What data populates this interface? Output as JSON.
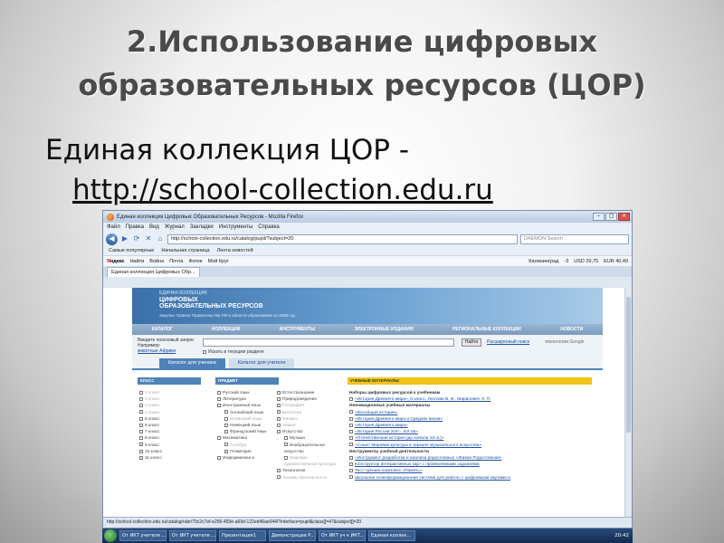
{
  "slide": {
    "title_line1": "2.Использование цифровых",
    "title_line2": "образовательных ресурсов (ЦОР)",
    "subtitle": "Единая коллекция ЦОР -",
    "url": "http://school-collection.edu.ru "
  },
  "browser": {
    "window_title": "Единая коллекция Цифровых Образовательных Ресурсов - Mozilla Firefox",
    "menu": [
      "Файл",
      "Правка",
      "Вид",
      "Журнал",
      "Закладки",
      "Инструменты",
      "Справка"
    ],
    "address": "http://school-collection.edu.ru/catalog/pupil/?subject=20",
    "search_placeholder": "DAEMON Search",
    "bookmarks": [
      "Самые популярные",
      "Начальная страница",
      "Лента новостей"
    ],
    "yandex_bar": {
      "logo_y": "Я",
      "logo_rest": "ндекс",
      "find": "Найти",
      "items": [
        "Война",
        "Почта",
        "Фотки",
        "Мой Круг"
      ],
      "city": "Калининград",
      "temp": "-3",
      "usd": "USD 29,75",
      "eur": "EUR 40,49"
    },
    "tab_label": "Единая коллекция Цифровых Обр...",
    "status": "http://school-collection.edu.ru/catalog/rubr/79c2c7ef-e256-493e-a69d-122ed46ae044/?interface=pupil&class[]=47&subject[]=20"
  },
  "site": {
    "banner_small": "ЕДИНАЯ КОЛЛЕКЦИЯ",
    "banner_big_1": "ЦИФРОВЫХ",
    "banner_big_2": "ОБРАЗОВАТЕЛЬНЫХ РЕСУРСОВ",
    "banner_note": "Закупка: Правое Правительства РФ в области образования за 2008 год",
    "nav": [
      "КАТАЛОГ",
      "КОЛЛЕКЦИИ",
      "ИНСТРУМЕНТЫ",
      "ЭЛЕКТРОННЫЕ ИЗДАНИЯ",
      "РЕГИОНАЛЬНЫЕ КОЛЛЕКЦИИ",
      "НОВОСТИ"
    ],
    "search_label_1": "Введите поисковый запрос",
    "search_label_2": "Например:",
    "search_example": "животные Африки",
    "search_button": "Найти",
    "advanced": "Расширенный поиск",
    "google": "технологии Google",
    "in_section": "Искать в текущем разделе",
    "tab_student": "Каталог для ученика",
    "tab_teacher": "Каталог для учителя",
    "col_class": "КЛАСС",
    "col_subject": "ПРЕДМЕТ",
    "col_materials": "УЧЕБНЫЕ МАТЕРИАЛЫ",
    "classes": [
      "1 класс",
      "2 класс",
      "3 класс",
      "4 класс",
      "5 класс",
      "6 класс",
      "7 класс",
      "8 класс",
      "9 класс",
      "10 класс",
      "11 класс"
    ],
    "subjects_a": [
      "Русский язык",
      "Литература",
      "Иностранный язык",
      "Английский язык",
      "Испанский язык",
      "Немецкий язык",
      "Французский язык",
      "Математика",
      "Алгебра",
      "Геометрия",
      "Информатика и"
    ],
    "subjects_b": [
      "Естествознание",
      "Природоведение",
      "География",
      "Биология",
      "Физика",
      "Химия",
      "Искусство",
      "Музыка",
      "Изобразительное искусство",
      "Мировая художественная культура",
      "Технология",
      "Основы безопасности"
    ],
    "mat_head1": "Наборы цифровых ресурсов к учебникам",
    "mat_items1": [
      "«История Древнего мира», 5 класс, Уколова В. И., Маринович Л. П."
    ],
    "mat_head2": "Инновационные учебные материалы",
    "mat_items2": [
      "«Всеобщая история»",
      "«История Древнего мира и Средних веков»",
      "«История Древнего мира»",
      "«История России XVII - XIX вв»",
      "«Отечественная история (до начала XX в.)»",
      "«Сонат. Мировая культура в зеркале музыкального искусства»"
    ],
    "mat_head3": "Инструменты учебной деятельности",
    "mat_items3": [
      "«Инструмент разработки и анализа родословных «Живая Родословная»",
      "Конструктор интерактивных карт с проверяемыми заданиями",
      "Тест-тренинг-комплекс «Память»",
      "Школьная геоинформационная система для работы с цифровыми картами и"
    ]
  },
  "taskbar": {
    "items": [
      "От ИКТ учителя ...",
      "От ИКТ учителя ...",
      "Презентация1",
      "Демонстрация Р...",
      "От ИКТ уч к ИКТ...",
      "Единая коллек..."
    ],
    "time": "20:42"
  }
}
